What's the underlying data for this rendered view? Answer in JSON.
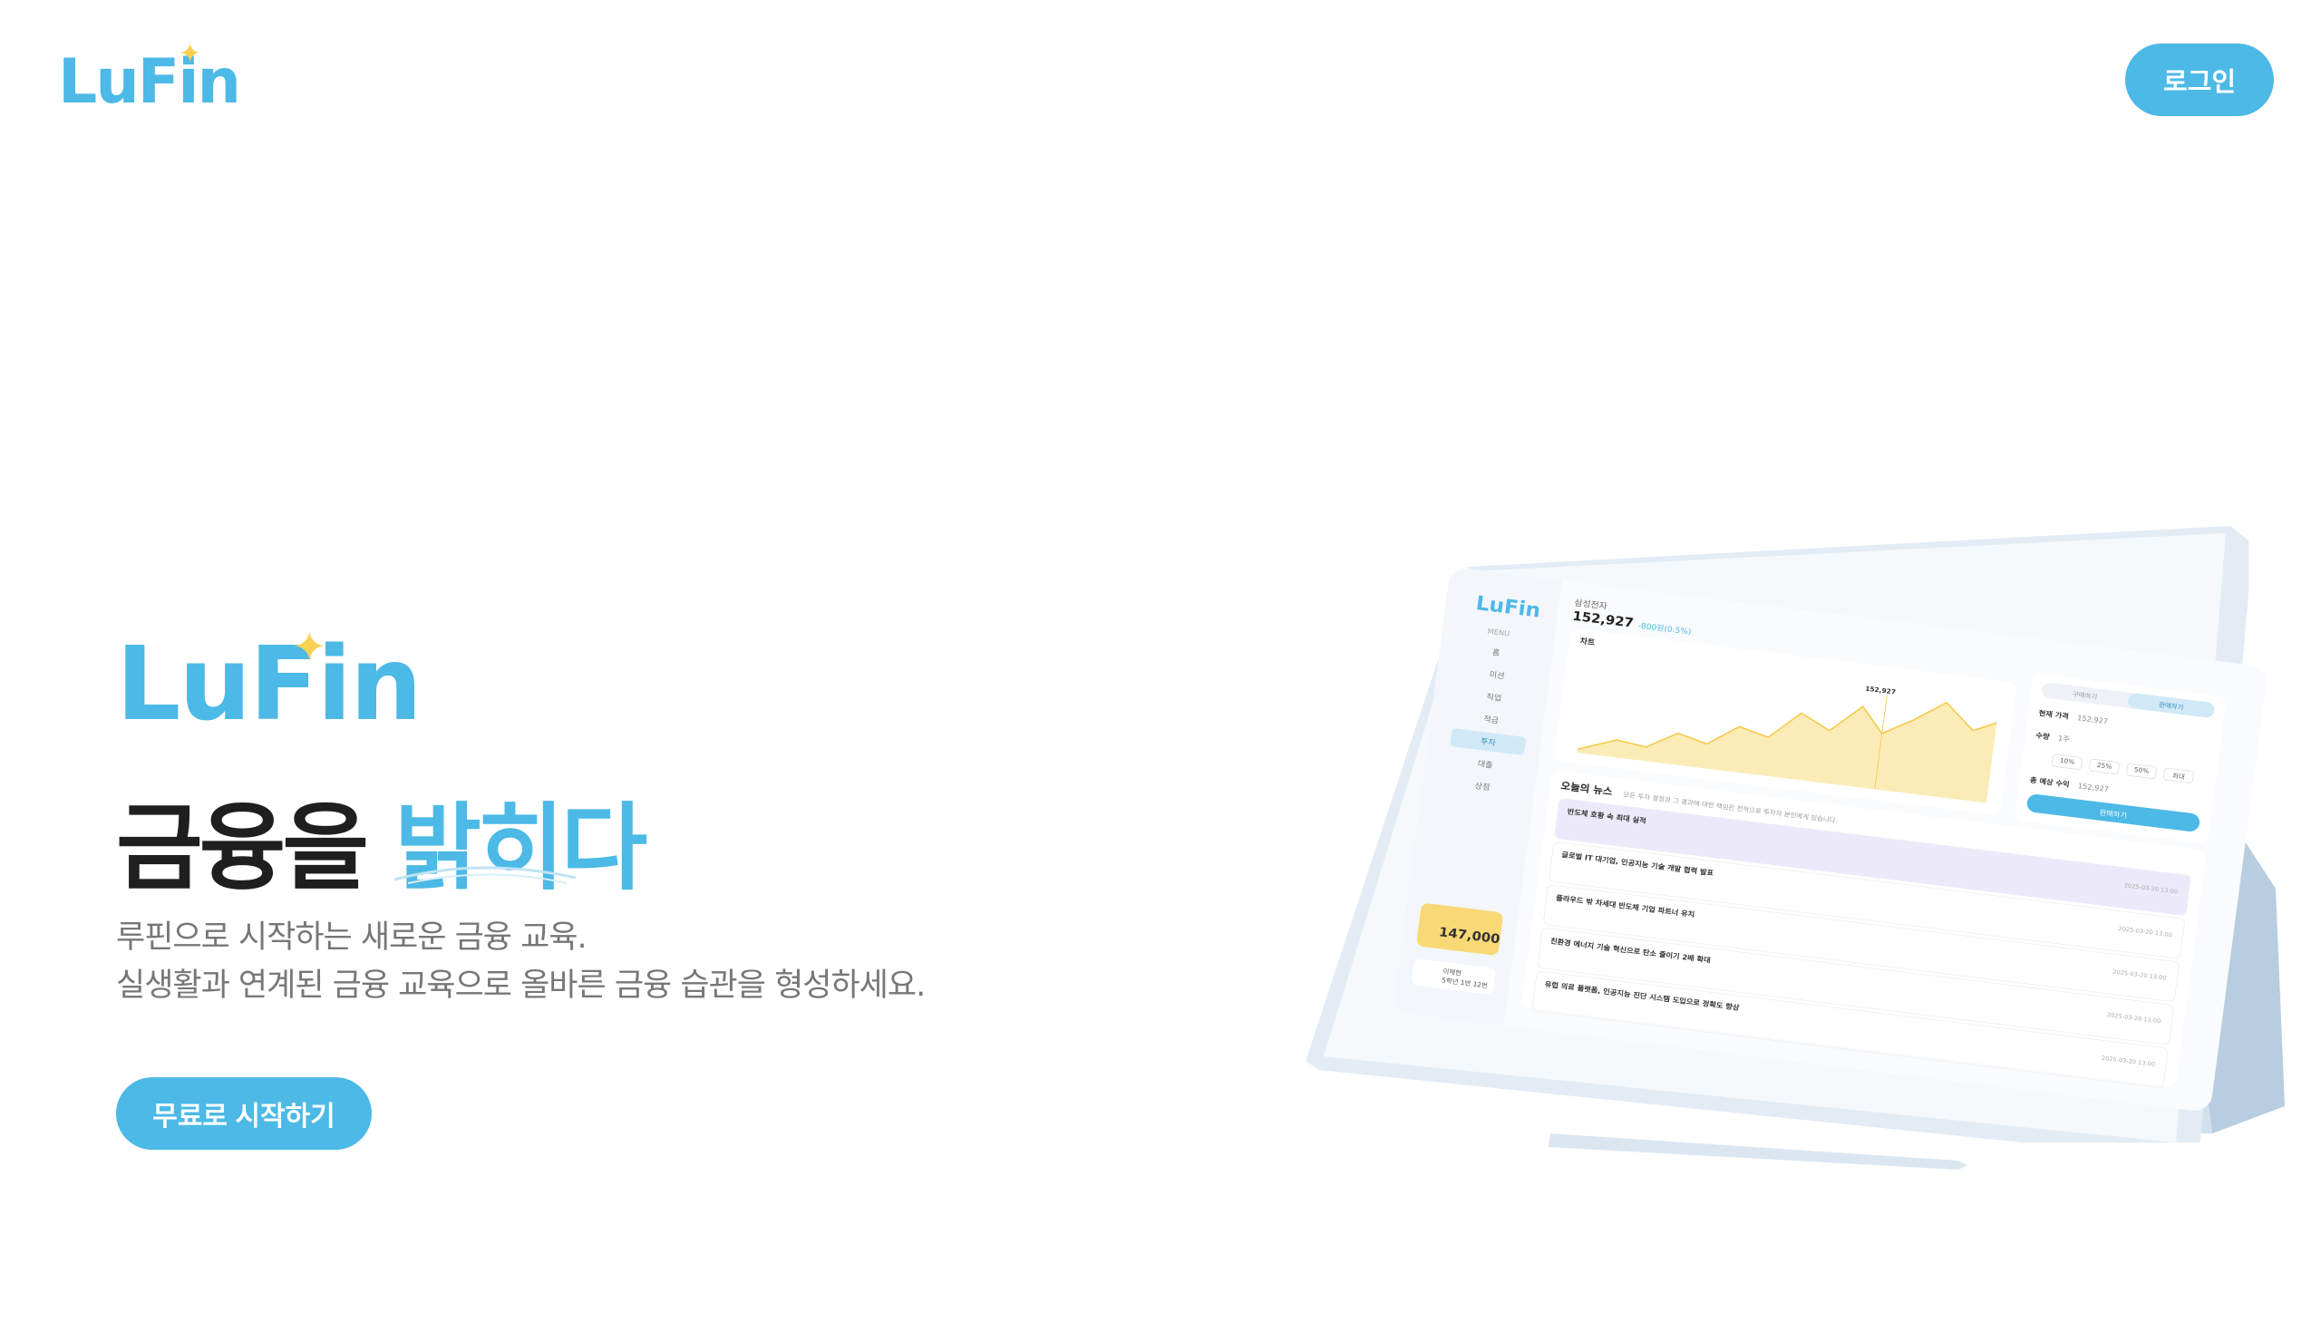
{
  "header": {
    "logo_text": "LuFin",
    "login_label": "로그인"
  },
  "hero": {
    "logo_text": "LuFin",
    "headline_dark": "금융을",
    "headline_blue": "밝히다",
    "sub_line1": "루핀으로 시작하는 새로운 금융 교육.",
    "sub_line2": "실생활과 연계된 금융 교육으로 올바른 금융 습관을 형성하세요.",
    "cta_label": "무료로 시작하기"
  },
  "mockup": {
    "logo_text": "LuFin",
    "menu_title": "MENU",
    "menu_items": [
      "홈",
      "미션",
      "직업",
      "적금",
      "투자",
      "대출",
      "상점"
    ],
    "active_menu": "투자",
    "balance": "147,000",
    "user_name": "이채현",
    "user_role": "5학년 1반 12번",
    "stock_name": "삼성전자",
    "price": "152,927",
    "price_change": "-800원(0.5%)",
    "chart_title": "차트",
    "chart_tooltip": "152,927",
    "tabs": [
      "구매하기",
      "판매하기"
    ],
    "current_price_label": "현재 가격",
    "current_price_value": "152,927",
    "qty_label": "수량",
    "qty_value": "1주",
    "pct_options": [
      "10%",
      "25%",
      "50%",
      "최대"
    ],
    "expected_label": "총 예상 수익",
    "expected_value": "152,927",
    "sell_label": "판매하기",
    "news_title": "오늘의 뉴스",
    "news_subtitle": "모든 투자 결정과 그 결과에 대한 책임은 전적으로 투자자 본인에게 있습니다.",
    "news": [
      {
        "headline": "반도체 호황 속 최대 실적",
        "date": "2025-03-20 13:00"
      },
      {
        "headline": "글로벌 IT 대기업, 인공지능 기술 개발 협력 발표",
        "date": "2025-03-20 13:00"
      },
      {
        "headline": "플라우드 밖 차세대 반도체 기업 파트너 유치",
        "date": "2025-03-20 13:00"
      },
      {
        "headline": "친환경 에너지 기술 혁신으로 탄소 줄이기 2배 확대",
        "date": "2025-03-20 13:00"
      },
      {
        "headline": "유럽 의료 플랫폼, 인공지능 진단 시스템 도입으로 정확도 향상",
        "date": "2025-03-20 13:00"
      }
    ]
  },
  "colors": {
    "brand_blue": "#4cb9e6",
    "sparkle_yellow": "#f7d154",
    "headline_dark": "#1f1f1f",
    "subtext_gray": "#777777"
  }
}
